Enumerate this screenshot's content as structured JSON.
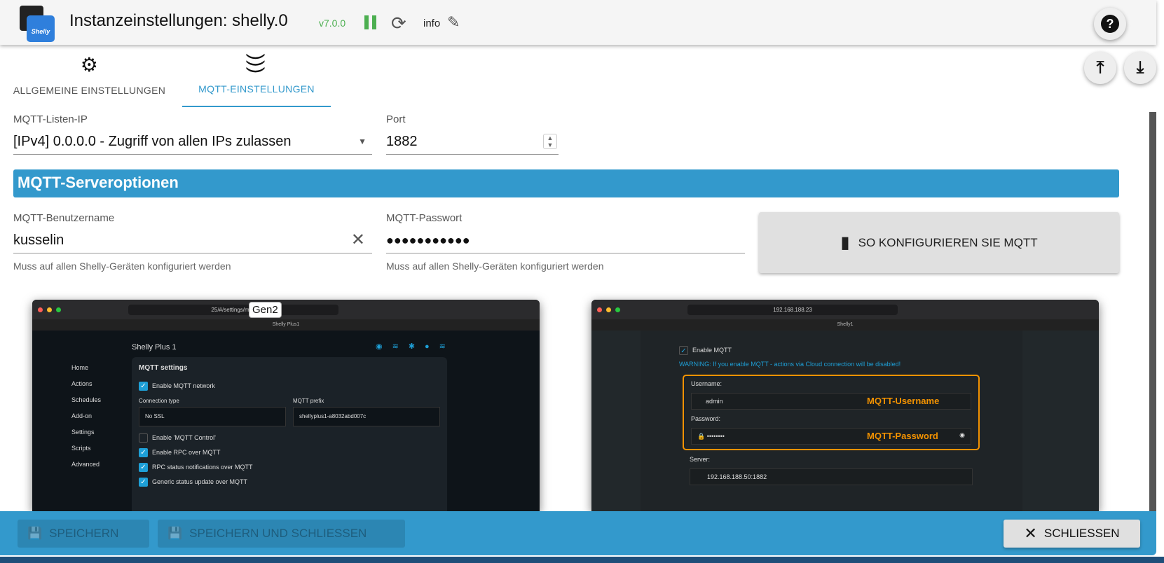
{
  "header": {
    "title": "Instanzeinstellungen: shelly.0",
    "version": "v7.0.0",
    "info_label": "info",
    "logo_text": "Shelly"
  },
  "tabs": [
    {
      "label": "ALLGEMEINE EINSTELLUNGEN",
      "icon": "gear-icon"
    },
    {
      "label": "MQTT-EINSTELLUNGEN",
      "icon": "rss-icon"
    }
  ],
  "form": {
    "listen_ip": {
      "label": "MQTT-Listen-IP",
      "value": "[IPv4] 0.0.0.0 - Zugriff von allen IPs zulassen"
    },
    "port": {
      "label": "Port",
      "value": "1882"
    },
    "section_title": "MQTT-Serveroptionen",
    "username": {
      "label": "MQTT-Benutzername",
      "value": "kusselin",
      "helper": "Muss auf allen Shelly-Geräten konfiguriert werden"
    },
    "password": {
      "label": "MQTT-Passwort",
      "value": "●●●●●●●●●●●",
      "helper": "Muss auf allen Shelly-Geräten konfiguriert werden"
    },
    "howto_button": "SO KONFIGURIEREN SIE MQTT"
  },
  "gen2": {
    "badge": "Gen2",
    "url": "25/#/settings/mqtt",
    "tab": "Shelly Plus1",
    "device": "Shelly Plus 1",
    "nav": [
      "Home",
      "Actions",
      "Schedules",
      "Add-on",
      "Settings",
      "Scripts",
      "Advanced"
    ],
    "panel_title": "MQTT settings",
    "enable_network": "Enable MQTT network",
    "conn_type_label": "Connection type",
    "conn_type": "No SSL",
    "prefix_label": "MQTT prefix",
    "prefix": "shellyplus1-a8032abd007c",
    "enable_control": "Enable 'MQTT Control'",
    "rpc": "Enable RPC over MQTT",
    "rpc_status": "RPC status notifications over MQTT",
    "generic": "Generic status update over MQTT"
  },
  "gen1": {
    "url": "192.168.188.23",
    "tab": "Shelly1",
    "enable": "Enable MQTT",
    "warning": "WARNING: If you enable MQTT - actions via Cloud connection will be disabled!",
    "username_label": "Username:",
    "username": "admin",
    "username_note": "MQTT-Username",
    "password_label": "Password:",
    "password": "••••••••",
    "password_note": "MQTT-Password",
    "server_label": "Server:",
    "server": "192.168.188.50:1882"
  },
  "footer": {
    "save": "SPEICHERN",
    "save_close": "SPEICHERN UND SCHLIESSEN",
    "close": "SCHLIESSEN"
  },
  "colors": {
    "accent": "#3399cc",
    "running": "#4caf50",
    "highlight": "#f39200"
  }
}
